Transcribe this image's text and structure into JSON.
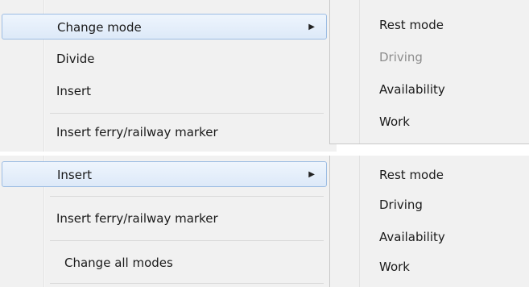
{
  "top_menu": {
    "items": [
      {
        "label": "Change mode",
        "has_submenu": true,
        "highlighted": true
      },
      {
        "label": "Divide",
        "has_submenu": false
      },
      {
        "label": "Insert",
        "has_submenu": true
      },
      {
        "label": "Insert ferry/railway marker",
        "has_submenu": false
      }
    ],
    "submenu": {
      "items": [
        {
          "label": "Rest mode",
          "disabled": false
        },
        {
          "label": "Driving",
          "disabled": true
        },
        {
          "label": "Availability",
          "disabled": false
        },
        {
          "label": "Work",
          "disabled": false
        }
      ]
    }
  },
  "bottom_menu": {
    "items": [
      {
        "label": "Insert",
        "has_submenu": true,
        "highlighted": true
      },
      {
        "label": "Insert ferry/railway marker",
        "has_submenu": false
      },
      {
        "label": "Change all modes",
        "has_submenu": true
      }
    ],
    "submenu": {
      "items": [
        {
          "label": "Rest mode",
          "disabled": false
        },
        {
          "label": "Driving",
          "disabled": false
        },
        {
          "label": "Availability",
          "disabled": false
        },
        {
          "label": "Work",
          "disabled": false
        }
      ]
    }
  },
  "icons": {
    "submenu_arrow": "triangle-right-icon"
  }
}
